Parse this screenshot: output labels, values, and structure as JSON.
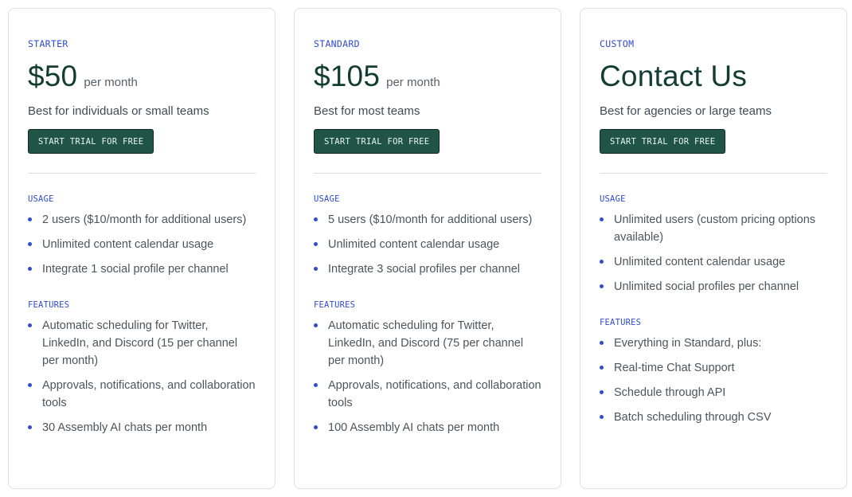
{
  "plans": [
    {
      "tier": "STARTER",
      "price": "$50",
      "per": "per month",
      "description": "Best for individuals or small teams",
      "cta": "START TRIAL FOR FREE",
      "usage_title": "USAGE",
      "usage": [
        "2 users ($10/month for additional users)",
        "Unlimited content calendar usage",
        "Integrate 1 social profile per channel"
      ],
      "features_title": "FEATURES",
      "features": [
        "Automatic scheduling for Twitter, LinkedIn, and Discord (15 per channel per month)",
        "Approvals, notifications, and collaboration tools",
        "30 Assembly AI chats per month"
      ]
    },
    {
      "tier": "STANDARD",
      "price": "$105",
      "per": "per month",
      "description": "Best for most teams",
      "cta": "START TRIAL FOR FREE",
      "usage_title": "USAGE",
      "usage": [
        "5 users ($10/month for additional users)",
        "Unlimited content calendar usage",
        "Integrate 3 social profiles per channel"
      ],
      "features_title": "FEATURES",
      "features": [
        "Automatic scheduling for Twitter, LinkedIn, and Discord (75 per channel per month)",
        "Approvals, notifications, and collaboration tools",
        "100 Assembly AI chats per month"
      ]
    },
    {
      "tier": "CUSTOM",
      "price": "Contact Us",
      "per": "",
      "description": "Best for agencies or large teams",
      "cta": "START TRIAL FOR FREE",
      "usage_title": "USAGE",
      "usage": [
        "Unlimited users (custom pricing options available)",
        "Unlimited content calendar usage",
        "Unlimited social profiles per channel"
      ],
      "features_title": "FEATURES",
      "features": [
        "Everything in Standard, plus:",
        "Real-time Chat Support",
        "Schedule through API",
        "Batch scheduling through CSV"
      ]
    }
  ],
  "colors": {
    "accent": "#2f4bd0",
    "button": "#1f5446",
    "price": "#123d30"
  }
}
